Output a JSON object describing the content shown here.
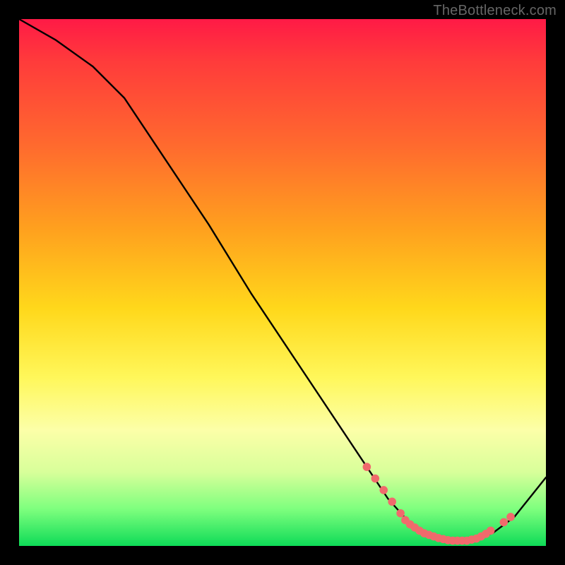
{
  "attribution": "TheBottleneck.com",
  "chart_data": {
    "type": "line",
    "title": "",
    "xlabel": "",
    "ylabel": "",
    "xlim": [
      0,
      100
    ],
    "ylim": [
      0,
      100
    ],
    "curve": {
      "name": "bottleneck-curve",
      "x": [
        0,
        7,
        14,
        20,
        28,
        36,
        44,
        52,
        60,
        66,
        70,
        74,
        78,
        82,
        86,
        90,
        94,
        100
      ],
      "y": [
        100,
        96,
        91,
        85,
        73,
        61,
        48,
        36,
        24,
        15,
        9,
        4.5,
        2,
        1,
        1,
        2.5,
        5.5,
        13
      ]
    },
    "highlight_points": {
      "color": "#f06a6c",
      "points": [
        {
          "x": 66,
          "y": 15
        },
        {
          "x": 67.6,
          "y": 12.8
        },
        {
          "x": 69.2,
          "y": 10.6
        },
        {
          "x": 70.8,
          "y": 8.4
        },
        {
          "x": 72.4,
          "y": 6.2
        },
        {
          "x": 73.3,
          "y": 4.9
        },
        {
          "x": 74.2,
          "y": 4.1
        },
        {
          "x": 75.1,
          "y": 3.5
        },
        {
          "x": 76.0,
          "y": 2.9
        },
        {
          "x": 76.9,
          "y": 2.4
        },
        {
          "x": 77.8,
          "y": 2.1
        },
        {
          "x": 78.7,
          "y": 1.8
        },
        {
          "x": 79.6,
          "y": 1.5
        },
        {
          "x": 80.5,
          "y": 1.3
        },
        {
          "x": 81.4,
          "y": 1.1
        },
        {
          "x": 82.3,
          "y": 1.0
        },
        {
          "x": 83.2,
          "y": 1.0
        },
        {
          "x": 84.1,
          "y": 1.0
        },
        {
          "x": 85.0,
          "y": 1.0
        },
        {
          "x": 85.9,
          "y": 1.2
        },
        {
          "x": 86.8,
          "y": 1.4
        },
        {
          "x": 87.7,
          "y": 1.8
        },
        {
          "x": 88.6,
          "y": 2.3
        },
        {
          "x": 89.5,
          "y": 2.9
        },
        {
          "x": 92.0,
          "y": 4.5
        },
        {
          "x": 93.3,
          "y": 5.5
        }
      ]
    }
  }
}
